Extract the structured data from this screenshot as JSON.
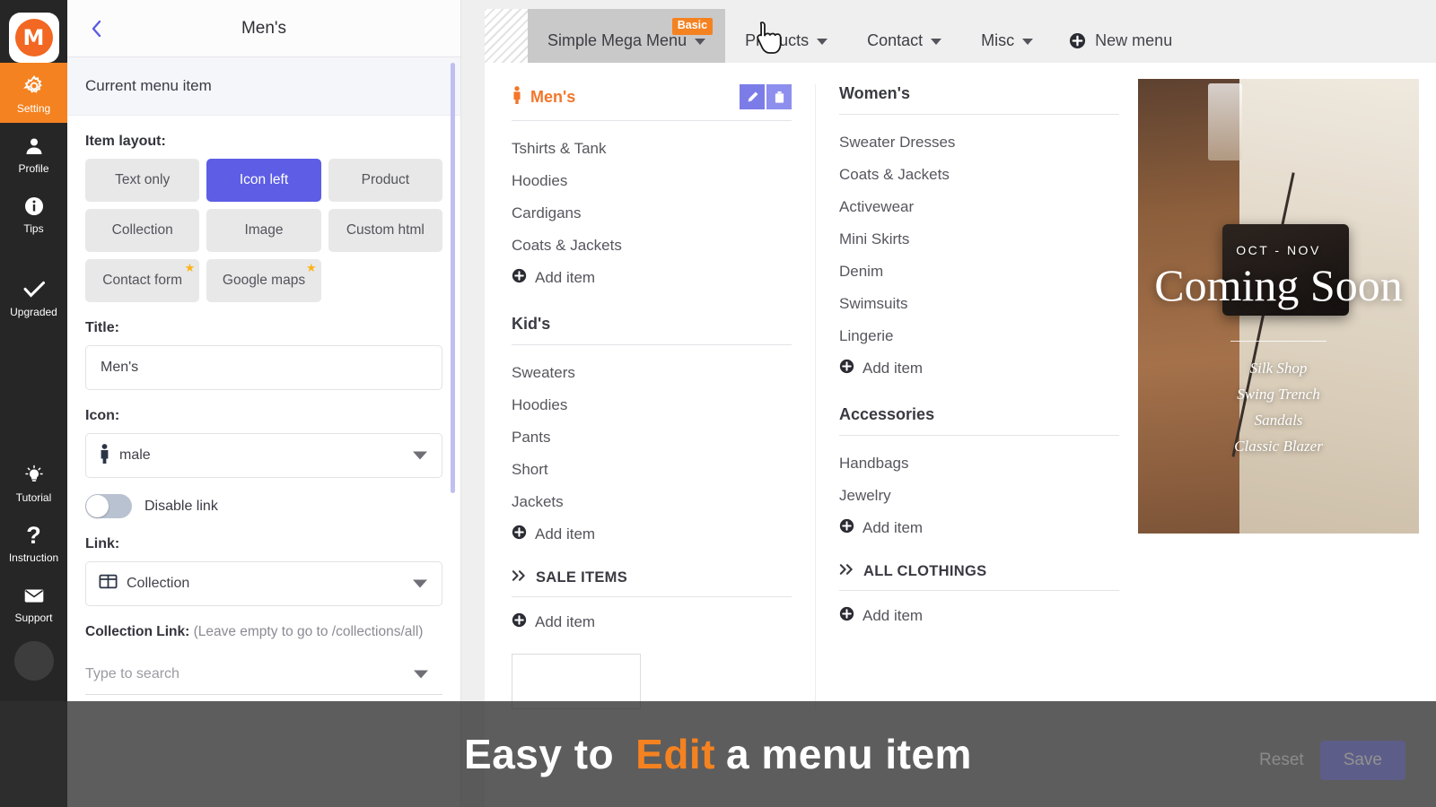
{
  "rail": {
    "logo_letter": "M",
    "items": [
      {
        "label": "Setting",
        "icon": "gear-icon",
        "active": true
      },
      {
        "label": "Profile",
        "icon": "user-icon",
        "active": false
      },
      {
        "label": "Tips",
        "icon": "info-icon",
        "active": false
      },
      {
        "label": "Upgraded",
        "icon": "check-icon",
        "active": false
      },
      {
        "label": "Tutorial",
        "icon": "lightbulb-icon",
        "active": false
      },
      {
        "label": "Instruction",
        "icon": "question-icon",
        "active": false
      },
      {
        "label": "Support",
        "icon": "envelope-icon",
        "active": false
      }
    ]
  },
  "panel": {
    "title": "Men's",
    "back_icon": "chevron-left-icon",
    "section_label": "Current menu item",
    "item_layout_label": "Item layout:",
    "layout_options": [
      {
        "label": "Text only",
        "selected": false,
        "pro": false
      },
      {
        "label": "Icon left",
        "selected": true,
        "pro": false
      },
      {
        "label": "Product",
        "selected": false,
        "pro": false
      },
      {
        "label": "Collection",
        "selected": false,
        "pro": false
      },
      {
        "label": "Image",
        "selected": false,
        "pro": false
      },
      {
        "label": "Custom html",
        "selected": false,
        "pro": false
      },
      {
        "label": "Contact form",
        "selected": false,
        "pro": true
      },
      {
        "label": "Google maps",
        "selected": false,
        "pro": true
      }
    ],
    "title_label": "Title:",
    "title_value": "Men's",
    "icon_label": "Icon:",
    "icon_value": "male",
    "disable_link_label": "Disable link",
    "disable_link_on": false,
    "link_label": "Link:",
    "link_value": "Collection",
    "collection_link_label": "Collection Link:",
    "collection_link_hint": "(Leave empty to go to /collections/all)",
    "collection_search_placeholder": "Type to search"
  },
  "tabs": {
    "items": [
      {
        "label": "Simple Mega Menu",
        "badge": "Basic",
        "active": true
      },
      {
        "label": "Products",
        "badge": "",
        "active": false
      },
      {
        "label": "Contact",
        "badge": "",
        "active": false
      },
      {
        "label": "Misc",
        "badge": "",
        "active": false
      }
    ],
    "new_menu_label": "New menu"
  },
  "mega": {
    "add_item_label": "Add item",
    "columns": [
      {
        "blocks": [
          {
            "type": "section",
            "heading": "Men's",
            "heading_icon": "male-icon",
            "accent": true,
            "has_actions": true,
            "actions": [
              {
                "name": "edit-icon"
              },
              {
                "name": "trash-icon"
              }
            ],
            "items": [
              "Tshirts & Tank",
              "Hoodies",
              "Cardigans",
              "Coats & Jackets"
            ]
          },
          {
            "type": "section",
            "heading": "Kid's",
            "accent": false,
            "has_actions": false,
            "items": [
              "Sweaters",
              "Hoodies",
              "Pants",
              "Short",
              "Jackets"
            ]
          },
          {
            "type": "group",
            "heading": "SALE ITEMS",
            "heading_icon": "double-chevron-right-icon",
            "items": []
          }
        ]
      },
      {
        "blocks": [
          {
            "type": "section",
            "heading": "Women's",
            "accent": false,
            "has_actions": false,
            "items": [
              "Sweater Dresses",
              "Coats & Jackets",
              "Activewear",
              "Mini Skirts",
              "Denim",
              "Swimsuits",
              "Lingerie"
            ]
          },
          {
            "type": "section",
            "heading": "Accessories",
            "accent": false,
            "has_actions": false,
            "items": [
              "Handbags",
              "Jewelry"
            ]
          },
          {
            "type": "group",
            "heading": "ALL CLOTHINGS",
            "heading_icon": "double-chevron-right-icon",
            "items": []
          }
        ]
      }
    ]
  },
  "promo": {
    "kicker": "OCT - NOV",
    "title": "Coming Soon",
    "list": [
      "Silk Shop",
      "Swing Trench",
      "Sandals",
      "Classic Blazer"
    ]
  },
  "caption": {
    "part1": "Easy to",
    "highlight": "Edit",
    "part2": "a menu item"
  },
  "footer": {
    "reset_label": "Reset",
    "save_label": "Save"
  },
  "colors": {
    "accent_orange": "#f58220",
    "accent_purple": "#5d5de6",
    "rail_bg": "#262626",
    "star_gold": "#fcb316"
  }
}
